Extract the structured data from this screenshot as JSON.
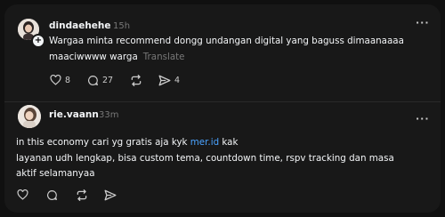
{
  "post1": {
    "username": "dindaehehe",
    "time": "15h",
    "line1": "Wargaa minta recommend dongg undangan digital yang baguss dimaanaaaa",
    "line2": "maaciwwww warga",
    "translate": "Translate",
    "likes": "8",
    "replies": "27",
    "shares": "4",
    "more": "···"
  },
  "post2": {
    "username": "rie.vaann",
    "time": "33m",
    "line1_pre": "in this economy cari yg gratis aja kyk ",
    "line1_link": "mer.id",
    "line1_post": " kak",
    "line2": "layanan udh lengkap, bisa custom tema, countdown time, rspv tracking dan masa",
    "line3": "aktif selamanyaa",
    "more": "···"
  },
  "icons": {
    "like": "heart-icon",
    "reply": "comment-icon",
    "repost": "repost-icon",
    "share": "send-icon",
    "follow": "plus-icon"
  }
}
